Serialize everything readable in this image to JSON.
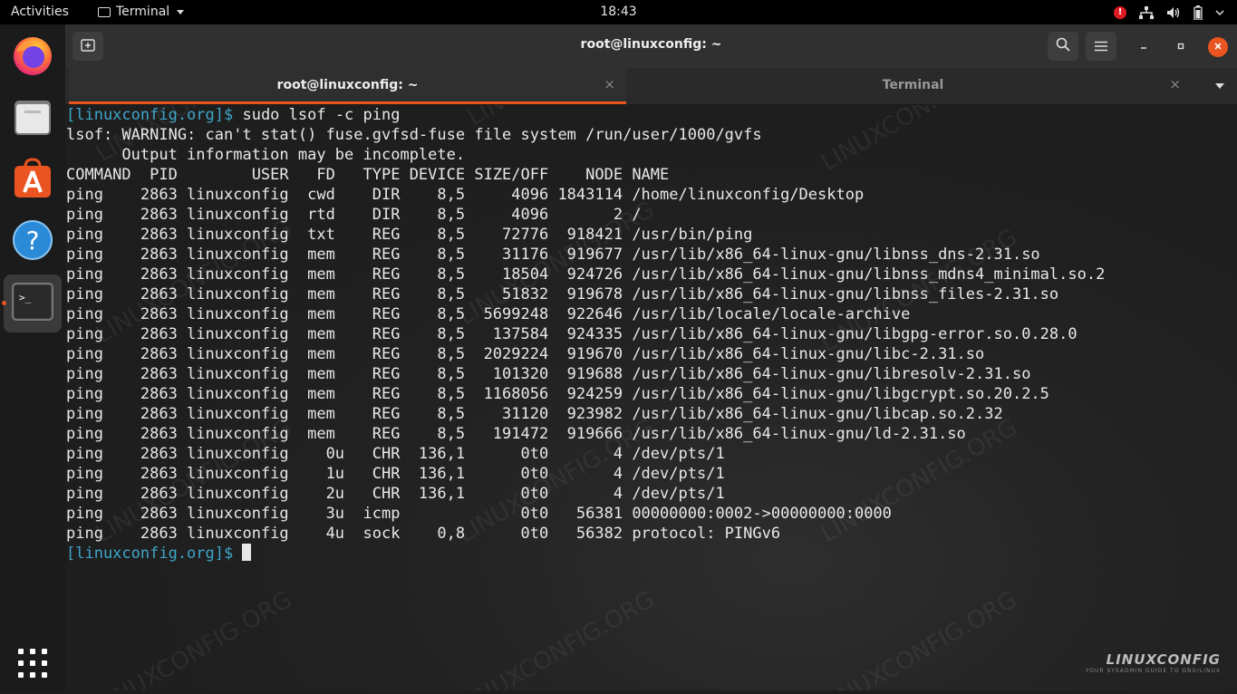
{
  "topbar": {
    "activities": "Activities",
    "app_name": "Terminal",
    "clock": "18:43",
    "alert": "!"
  },
  "dock": {
    "items": [
      "firefox-icon",
      "files-icon",
      "software-icon",
      "help-icon",
      "terminal-icon"
    ],
    "show_apps": "apps-grid-icon"
  },
  "window": {
    "title": "root@linuxconfig: ~",
    "tabs": [
      {
        "label": "root@linuxconfig: ~",
        "active": true
      },
      {
        "label": "Terminal",
        "active": false
      }
    ],
    "tab_close": "×"
  },
  "terminal": {
    "prompt": "[linuxconfig.org]$",
    "command": " sudo lsof -c ping",
    "output": [
      "lsof: WARNING: can't stat() fuse.gvfsd-fuse file system /run/user/1000/gvfs",
      "      Output information may be incomplete.",
      "COMMAND  PID        USER   FD   TYPE DEVICE SIZE/OFF    NODE NAME",
      "ping    2863 linuxconfig  cwd    DIR    8,5     4096 1843114 /home/linuxconfig/Desktop",
      "ping    2863 linuxconfig  rtd    DIR    8,5     4096       2 /",
      "ping    2863 linuxconfig  txt    REG    8,5    72776  918421 /usr/bin/ping",
      "ping    2863 linuxconfig  mem    REG    8,5    31176  919677 /usr/lib/x86_64-linux-gnu/libnss_dns-2.31.so",
      "ping    2863 linuxconfig  mem    REG    8,5    18504  924726 /usr/lib/x86_64-linux-gnu/libnss_mdns4_minimal.so.2",
      "ping    2863 linuxconfig  mem    REG    8,5    51832  919678 /usr/lib/x86_64-linux-gnu/libnss_files-2.31.so",
      "ping    2863 linuxconfig  mem    REG    8,5  5699248  922646 /usr/lib/locale/locale-archive",
      "ping    2863 linuxconfig  mem    REG    8,5   137584  924335 /usr/lib/x86_64-linux-gnu/libgpg-error.so.0.28.0",
      "ping    2863 linuxconfig  mem    REG    8,5  2029224  919670 /usr/lib/x86_64-linux-gnu/libc-2.31.so",
      "ping    2863 linuxconfig  mem    REG    8,5   101320  919688 /usr/lib/x86_64-linux-gnu/libresolv-2.31.so",
      "ping    2863 linuxconfig  mem    REG    8,5  1168056  924259 /usr/lib/x86_64-linux-gnu/libgcrypt.so.20.2.5",
      "ping    2863 linuxconfig  mem    REG    8,5    31120  923982 /usr/lib/x86_64-linux-gnu/libcap.so.2.32",
      "ping    2863 linuxconfig  mem    REG    8,5   191472  919666 /usr/lib/x86_64-linux-gnu/ld-2.31.so",
      "ping    2863 linuxconfig    0u   CHR  136,1      0t0       4 /dev/pts/1",
      "ping    2863 linuxconfig    1u   CHR  136,1      0t0       4 /dev/pts/1",
      "ping    2863 linuxconfig    2u   CHR  136,1      0t0       4 /dev/pts/1",
      "ping    2863 linuxconfig    3u  icmp             0t0   56381 00000000:0002->00000000:0000",
      "ping    2863 linuxconfig    4u  sock    0,8      0t0   56382 protocol: PINGv6"
    ],
    "final_prompt": "[linuxconfig.org]$"
  },
  "watermark": {
    "text": "LINUXCONFIG.ORG",
    "logo": "LINUXCONFIG",
    "logo_sub": "YOUR SYSADMIN GUIDE TO GNU/LINUX"
  },
  "colors": {
    "accent": "#e95420",
    "prompt": "#3ea6c9",
    "terminal_bg": "#1e1e1e",
    "text": "#e8e8e8"
  }
}
